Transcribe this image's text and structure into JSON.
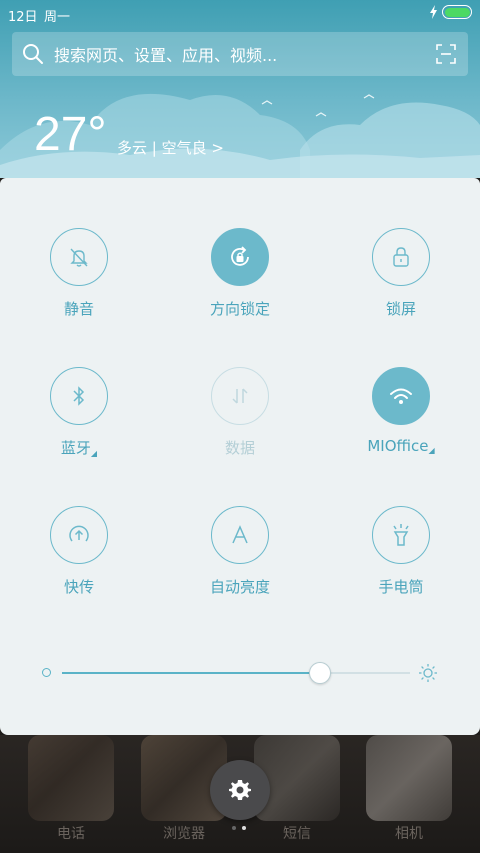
{
  "status_bar": {
    "date": "12日",
    "weekday": "周一",
    "battery_level": 1.0,
    "charging_icon": "lightning-icon"
  },
  "search": {
    "placeholder": "搜索网页、设置、应用、视频..."
  },
  "weather": {
    "temperature": "27°",
    "description": "多云 | 空气良 >"
  },
  "quick_settings": {
    "tiles": [
      {
        "label": "静音",
        "icon": "bell-muted-icon",
        "state": "off"
      },
      {
        "label": "方向锁定",
        "icon": "rotation-lock-icon",
        "state": "on"
      },
      {
        "label": "锁屏",
        "icon": "lock-icon",
        "state": "off"
      },
      {
        "label": "蓝牙",
        "icon": "bluetooth-icon",
        "state": "off",
        "has_menu": true
      },
      {
        "label": "数据",
        "icon": "mobile-data-icon",
        "state": "disabled"
      },
      {
        "label": "MIOffice",
        "icon": "wifi-icon",
        "state": "on",
        "has_menu": true
      },
      {
        "label": "快传",
        "icon": "transfer-icon",
        "state": "off"
      },
      {
        "label": "自动亮度",
        "icon": "auto-brightness-icon",
        "state": "off"
      },
      {
        "label": "手电筒",
        "icon": "flashlight-icon",
        "state": "off"
      }
    ],
    "brightness_level": 0.74
  },
  "dock": {
    "apps": [
      {
        "label": "电话"
      },
      {
        "label": "浏览器"
      },
      {
        "label": "短信"
      },
      {
        "label": "相机"
      }
    ],
    "page_count": 2,
    "active_page": 2
  },
  "colors": {
    "accent": "#6cb9cb",
    "panel_bg": "#edf2f3",
    "header_bg": "#5aaec2"
  }
}
